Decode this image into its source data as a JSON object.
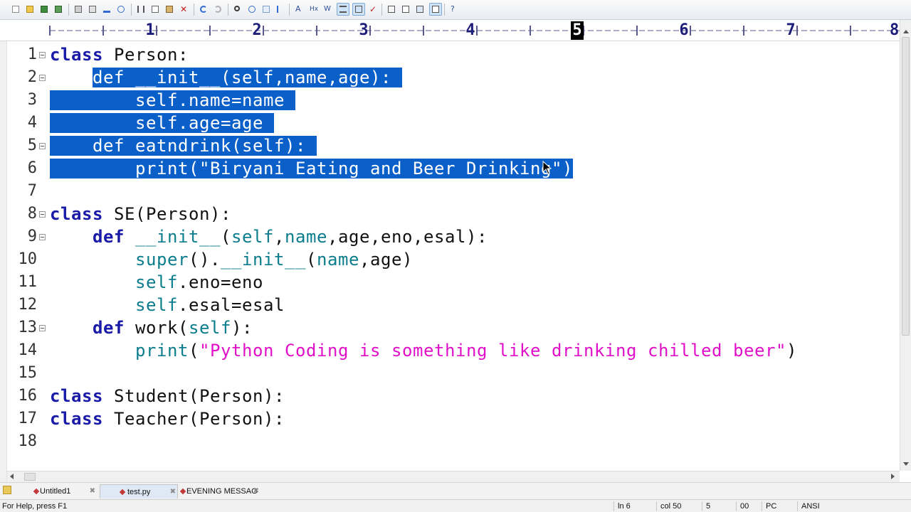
{
  "toolbar": {
    "icons": [
      "new-icon",
      "open-icon",
      "save-icon",
      "save-all-icon",
      "print-icon",
      "print-preview-icon",
      "spell-check-icon",
      "find-in-files-icon",
      "cut-icon",
      "copy-icon",
      "paste-icon",
      "delete-icon",
      "undo-icon",
      "redo-icon",
      "find-icon",
      "replace-icon",
      "goto-icon",
      "toggle-bookmark-icon",
      "word-wrap-icon",
      "hex-icon",
      "wrap-icon",
      "show-spaces-icon",
      "show-line-endings-icon",
      "spell-icon",
      "column-mode-icon",
      "format-icon",
      "window-icon",
      "fullscreen-icon",
      "help-icon"
    ],
    "active_icons": [
      "show-spaces-icon",
      "show-line-endings-icon",
      "fullscreen-icon"
    ]
  },
  "ruler": {
    "numbers": [
      "1",
      "2",
      "3",
      "4",
      "5",
      "6",
      "7",
      "8"
    ],
    "current_column_marker": "5"
  },
  "editor": {
    "lines": [
      {
        "num": "1",
        "fold": true,
        "text": "class Person:"
      },
      {
        "num": "2",
        "fold": true,
        "text": "    def __init__(self,name,age):"
      },
      {
        "num": "3",
        "fold": false,
        "text": "        self.name=name"
      },
      {
        "num": "4",
        "fold": false,
        "text": "        self.age=age"
      },
      {
        "num": "5",
        "fold": true,
        "text": "    def eatndrink(self):"
      },
      {
        "num": "6",
        "fold": false,
        "text": "        print(\"Biryani Eating and Beer Drinking\")"
      },
      {
        "num": "7",
        "fold": false,
        "text": ""
      },
      {
        "num": "8",
        "fold": true,
        "text": "class SE(Person):"
      },
      {
        "num": "9",
        "fold": true,
        "text": "    def __init__(self,name,age,eno,esal):"
      },
      {
        "num": "10",
        "fold": false,
        "text": "        super().__init__(name,age)"
      },
      {
        "num": "11",
        "fold": false,
        "text": "        self.eno=eno"
      },
      {
        "num": "12",
        "fold": false,
        "text": "        self.esal=esal"
      },
      {
        "num": "13",
        "fold": true,
        "text": "    def work(self):"
      },
      {
        "num": "14",
        "fold": false,
        "text": "        print(\"Python Coding is something like drinking chilled beer\")"
      },
      {
        "num": "15",
        "fold": false,
        "text": ""
      },
      {
        "num": "16",
        "fold": false,
        "text": "class Student(Person):"
      },
      {
        "num": "17",
        "fold": false,
        "text": "class Teacher(Person):"
      },
      {
        "num": "18",
        "fold": false,
        "text": ""
      }
    ],
    "selection": "lines 2-6",
    "caret_line": "6"
  },
  "tabs": [
    {
      "label": "Untitled1",
      "active": false
    },
    {
      "label": "test.py",
      "active": true
    },
    {
      "label": "EVENING MESSAG",
      "active": false
    }
  ],
  "status": {
    "help": "For Help, press F1",
    "line": "ln 6",
    "col": "col 50",
    "sel": "5",
    "code": "00",
    "platform": "PC",
    "encoding": "ANSI"
  },
  "colors": {
    "keyword": "#1a1aa8",
    "self": "#0b7d8c",
    "string": "#e010c8",
    "selection": "#0a5fc8"
  }
}
